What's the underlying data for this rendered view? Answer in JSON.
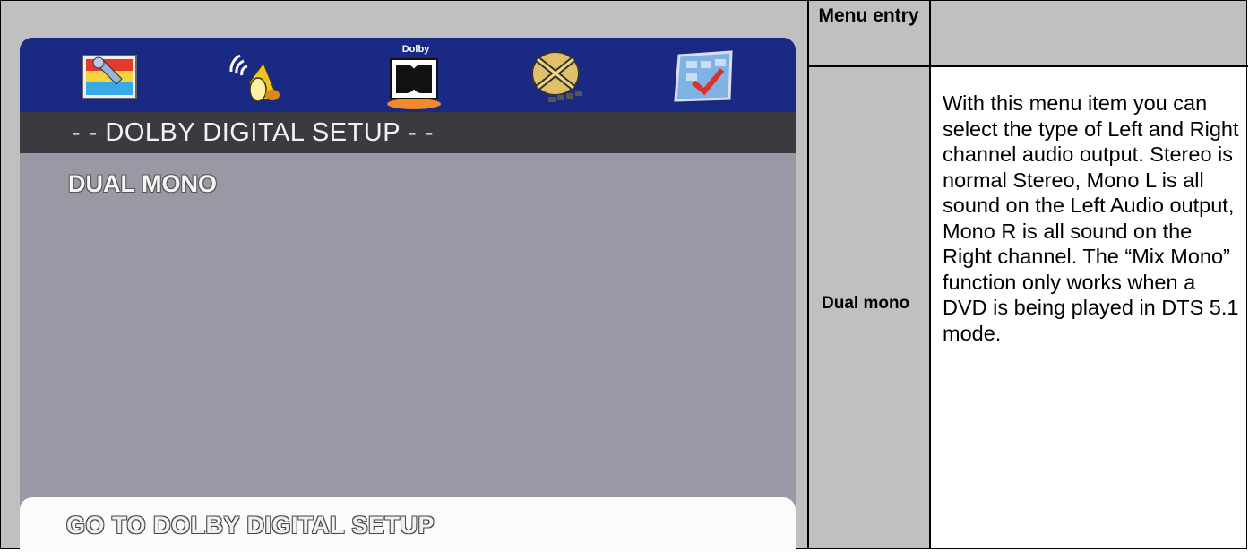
{
  "osd": {
    "icons": [
      {
        "name": "general-setup-icon"
      },
      {
        "name": "audio-setup-icon"
      },
      {
        "name": "dolby-digital-icon",
        "label": "Dolby"
      },
      {
        "name": "video-setup-icon"
      },
      {
        "name": "preference-setup-icon"
      }
    ],
    "section_title": "- - DOLBY DIGITAL SETUP - -",
    "menu_item": "DUAL MONO",
    "footer": "GO TO DOLBY DIGITAL SETUP"
  },
  "table": {
    "header": "Menu entry",
    "entry": "Dual mono",
    "description": "With this menu item you can select the type of Left and Right channel audio output. Stereo is normal Stereo, Mono L is all sound on the Left Audio output, Mono R is all sound on the Right channel. The “Mix Mono” function only works when a DVD is being played in DTS 5.1 mode."
  }
}
